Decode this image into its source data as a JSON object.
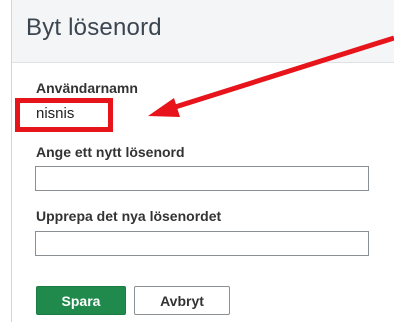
{
  "page": {
    "title": "Byt lösenord"
  },
  "form": {
    "username_label": "Användarnamn",
    "username_value": "nisnis",
    "new_password_label": "Ange ett nytt lösenord",
    "new_password_value": "",
    "repeat_password_label": "Upprepa det nya lösenordet",
    "repeat_password_value": ""
  },
  "actions": {
    "save_label": "Spara",
    "cancel_label": "Avbryt"
  },
  "colors": {
    "primary_button": "#1f8a4c",
    "annotation": "#e8141b",
    "header_background": "#f3f5f7"
  },
  "annotation": {
    "icon": "arrow-pointer-icon"
  }
}
